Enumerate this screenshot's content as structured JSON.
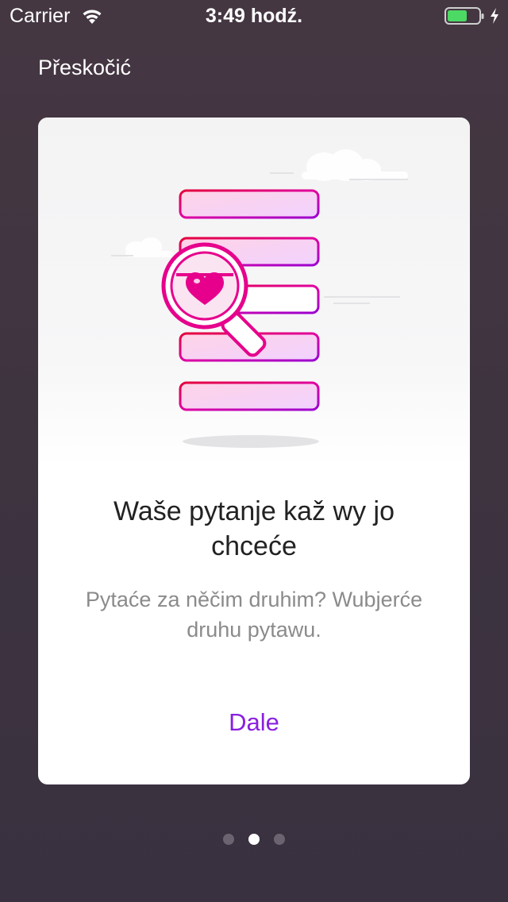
{
  "status_bar": {
    "carrier": "Carrier",
    "time": "3:49 hodź.",
    "battery_color": "#4cd964"
  },
  "skip_label": "Přeskočić",
  "card": {
    "illustration_icon": "magnifier-heart-list-icon",
    "title": "Waše pytanje kaž wy jo chceće",
    "subtitle": "Pytaće za něčim druhim? Wubjerće druhu pytawu.",
    "next_label": "Dale",
    "accent_color": "#8a1fe0",
    "pink_color": "#e6008c"
  },
  "pager": {
    "pages": 3,
    "current": 2
  }
}
